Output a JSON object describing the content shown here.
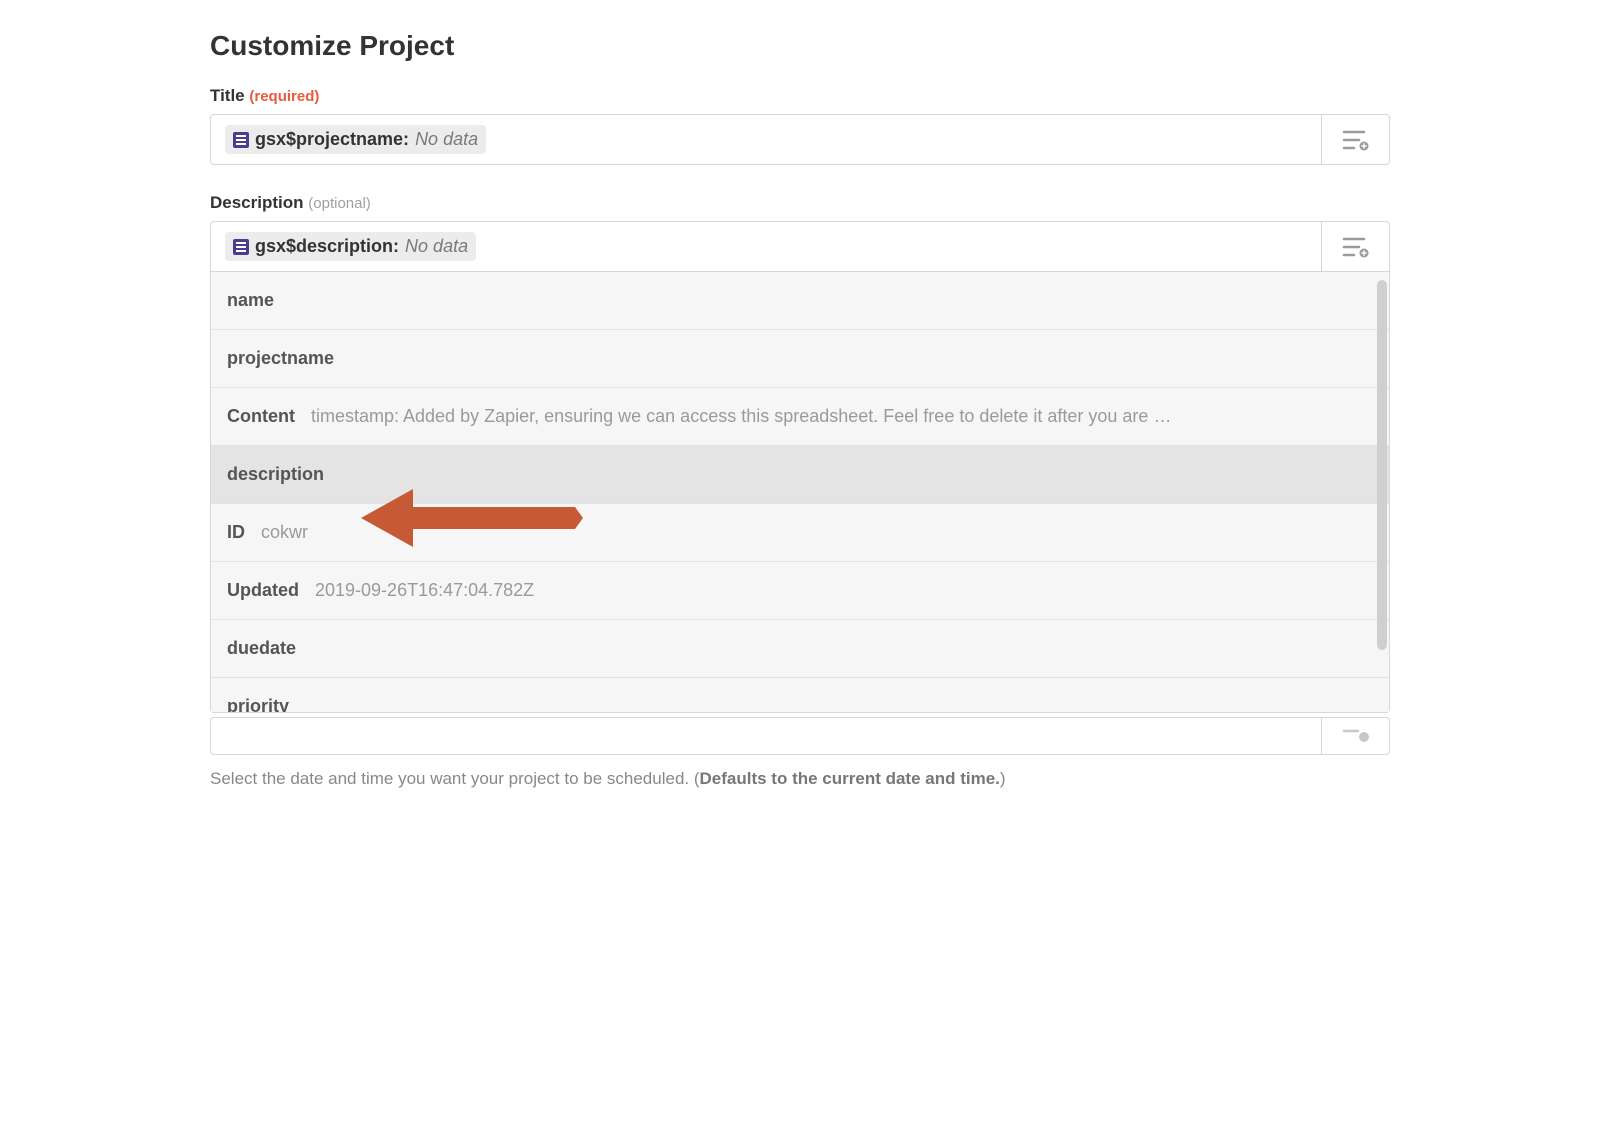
{
  "heading": "Customize Project",
  "title": {
    "label": "Title",
    "qualifier": "(required)",
    "pill_name": "gsx$projectname:",
    "pill_value": "No data"
  },
  "description": {
    "label": "Description",
    "qualifier": "(optional)",
    "pill_name": "gsx$description:",
    "pill_value": "No data"
  },
  "options": [
    {
      "key": "name",
      "val": ""
    },
    {
      "key": "projectname",
      "val": ""
    },
    {
      "key": "Content",
      "val": "timestamp: Added by Zapier, ensuring we can access this spreadsheet. Feel free to delete it after you are …"
    },
    {
      "key": "description",
      "val": ""
    },
    {
      "key": "ID",
      "val": "cokwr"
    },
    {
      "key": "Updated",
      "val": "2019-09-26T16:47:04.782Z"
    },
    {
      "key": "duedate",
      "val": ""
    },
    {
      "key": "priority",
      "val": ""
    }
  ],
  "help": {
    "prefix": "Select the date and time you want your project to be scheduled. (",
    "bold": "Defaults to the current date and time.",
    "suffix": ")"
  }
}
